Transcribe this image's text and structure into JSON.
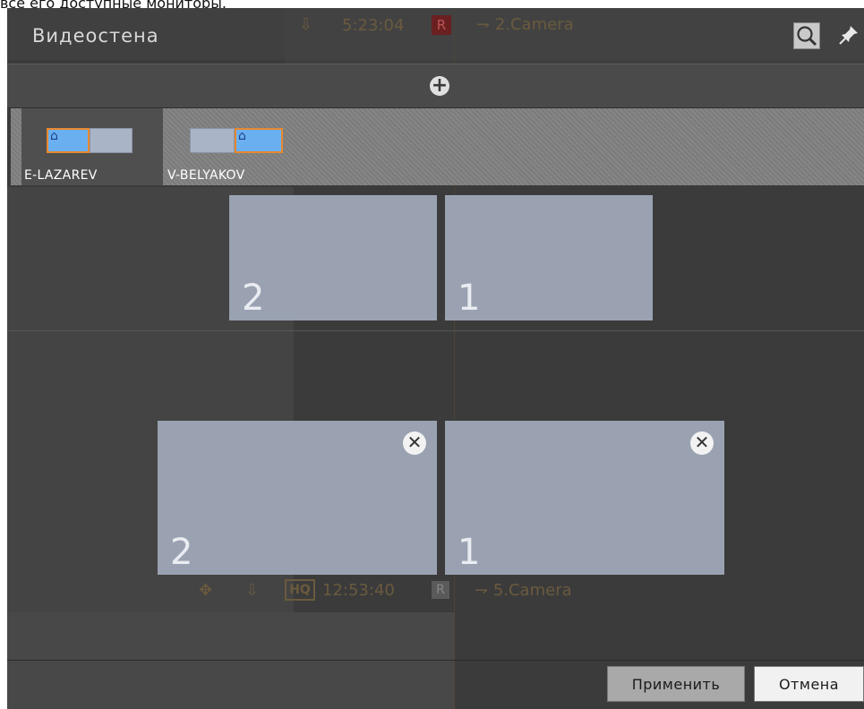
{
  "doc_caption": "все его доступные мониторы.",
  "header": {
    "title": "Видеостена",
    "background_time": "5:23:04",
    "background_r": "R",
    "background_camera": "2.Camera"
  },
  "tabs": [
    {
      "label": "E-LAZAREV",
      "active": true
    },
    {
      "label": "V-BELYAKOV",
      "active": false
    }
  ],
  "upper_slots": [
    {
      "number": "2"
    },
    {
      "number": "1"
    }
  ],
  "lower_slots": [
    {
      "number": "2"
    },
    {
      "number": "1"
    }
  ],
  "background_bottom": {
    "hq": "HQ",
    "time": "12:53:40",
    "r": "R",
    "camera": "5.Camera"
  },
  "footer": {
    "apply": "Применить",
    "cancel": "Отмена"
  },
  "icons": {
    "search": "search-icon",
    "pin": "pin-icon",
    "add": "plus-circle-icon",
    "close": "close-circle-icon",
    "home": "home-icon"
  },
  "colors": {
    "active_monitor": "#6ab0f0",
    "active_border": "#e8882e",
    "slot": "#9aa2b2"
  }
}
